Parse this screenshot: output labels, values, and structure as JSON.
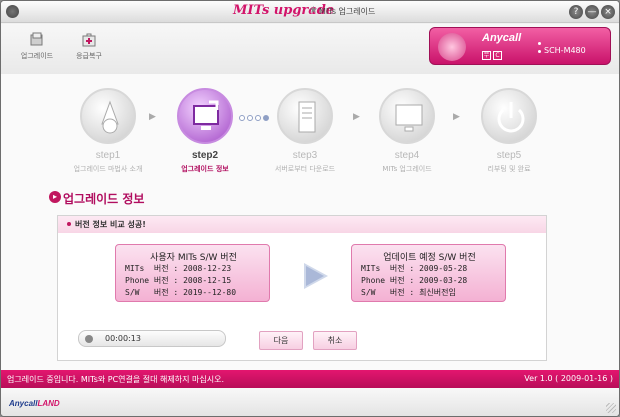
{
  "title": {
    "brand": "MITs upgrade",
    "star": "★",
    "subtitle": "MITs 업그레이드"
  },
  "titlebar_buttons": {
    "help": "?",
    "minimize": "—",
    "close": "×"
  },
  "toolbar": {
    "upgrade_label": "업그레이드",
    "emergency_label": "응급복구"
  },
  "device": {
    "brand": "Anycall",
    "model": "SCH-M480",
    "chip1": "무",
    "chip2": "C"
  },
  "steps": [
    {
      "name": "step1",
      "label": "업그레이드 마법사 소개"
    },
    {
      "name": "step2",
      "label": "업그레이드 정보"
    },
    {
      "name": "step3",
      "label": "서버로부터 다운로드"
    },
    {
      "name": "step4",
      "label": "MITs 업그레이드"
    },
    {
      "name": "step5",
      "label": "리부팅 및 완료"
    }
  ],
  "active_step": 2,
  "section": {
    "title": "업그레이드 정보",
    "icon": "arrow-circle-icon"
  },
  "panel": {
    "header": "버전 정보 비교 성공!",
    "current": {
      "title": "사용자 MITs S/W 버전",
      "line1": "MITs  버전 : 2008-12-23",
      "line2": "Phone 버전 : 2008-12-15",
      "line3": "S/W   버전 : 2019--12-80"
    },
    "target": {
      "title": "업데이트 예정 S/W 버전",
      "line1": "MITs  버전 : 2009-05-28",
      "line2": "Phone 버전 : 2009-03-28",
      "line3": "S/W   버전 : 최신버전임"
    },
    "elapsed": "00:00:13",
    "next_label": "다음",
    "cancel_label": "취소"
  },
  "status": {
    "message": "업그레이드 중입니다. MITs와 PC연결을 절대 해제하지 마십시오.",
    "version": "Ver 1.0 ( 2009-01-16 )"
  },
  "footer": {
    "brand_a": "Anycall",
    "brand_b": "LAND"
  },
  "colors": {
    "accent": "#d2146a",
    "status_bar": "#c8105f",
    "active_step": "#a24ac6"
  }
}
